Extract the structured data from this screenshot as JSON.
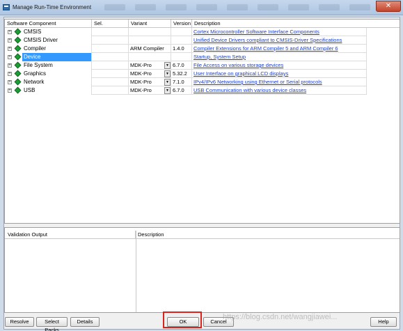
{
  "window": {
    "title": "Manage Run-Time Environment",
    "close_glyph": "✕"
  },
  "grid": {
    "columns": [
      "Software Component",
      "Sel.",
      "Variant",
      "Version",
      "Description"
    ],
    "rows": [
      {
        "name": "CMSIS",
        "sel": "",
        "variant": "",
        "version": "",
        "has_dropdown": false,
        "description": "Cortex Microcontroller Software Interface Components"
      },
      {
        "name": "CMSIS Driver",
        "sel": "",
        "variant": "",
        "version": "",
        "has_dropdown": false,
        "description": "Unified Device Drivers compliant to CMSIS-Driver Specifications"
      },
      {
        "name": "Compiler",
        "sel": "",
        "variant": "ARM Compiler",
        "version": "1.4.0",
        "has_dropdown": false,
        "description": "Compiler Extensions for ARM Compiler 5 and ARM Compiler 6"
      },
      {
        "name": "Device",
        "sel": "",
        "variant": "",
        "version": "",
        "has_dropdown": false,
        "description": "Startup, System Setup",
        "selected": true
      },
      {
        "name": "File System",
        "sel": "",
        "variant": "MDK-Pro",
        "version": "6.7.0",
        "has_dropdown": true,
        "description": "File Access on various storage devices"
      },
      {
        "name": "Graphics",
        "sel": "",
        "variant": "MDK-Pro",
        "version": "5.32.2",
        "has_dropdown": true,
        "description": "User Interface on graphical LCD displays"
      },
      {
        "name": "Network",
        "sel": "",
        "variant": "MDK-Pro",
        "version": "7.1.0",
        "has_dropdown": true,
        "description": "IPv4/IPv6 Networking using Ethernet or Serial protocols"
      },
      {
        "name": "USB",
        "sel": "",
        "variant": "MDK-Pro",
        "version": "6.7.0",
        "has_dropdown": true,
        "description": "USB Communication with various device classes"
      }
    ],
    "expander_glyph": "+",
    "dropdown_glyph": "▼"
  },
  "validation": {
    "output_label": "Validation Output",
    "description_label": "Description"
  },
  "buttons": {
    "resolve": "Resolve",
    "select_packs": "Select Packs",
    "details": "Details",
    "ok": "OK",
    "cancel": "Cancel",
    "help": "Help"
  },
  "watermark": "https://blog.csdn.net/wangjiawei..."
}
